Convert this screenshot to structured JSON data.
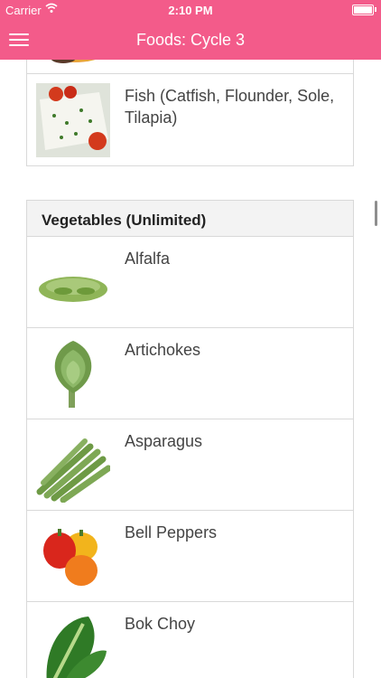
{
  "status": {
    "carrier": "Carrier",
    "time": "2:10 PM"
  },
  "nav": {
    "title": "Foods: Cycle 3",
    "menu_icon": "hamburger-menu-icon"
  },
  "proteins": {
    "items": [
      {
        "label": "",
        "icon": "protein-image"
      },
      {
        "label": "Fish (Catfish, Flounder, Sole, Tilapia)",
        "icon": "fish-image"
      }
    ]
  },
  "vegetables": {
    "header": "Vegetables (Unlimited)",
    "items": [
      {
        "label": "Alfalfa",
        "icon": "alfalfa-image"
      },
      {
        "label": "Artichokes",
        "icon": "artichoke-image"
      },
      {
        "label": "Asparagus",
        "icon": "asparagus-image"
      },
      {
        "label": "Bell Peppers",
        "icon": "bell-pepper-image"
      },
      {
        "label": "Bok Choy",
        "icon": "bok-choy-image"
      }
    ]
  },
  "colors": {
    "accent": "#f35b8a"
  }
}
